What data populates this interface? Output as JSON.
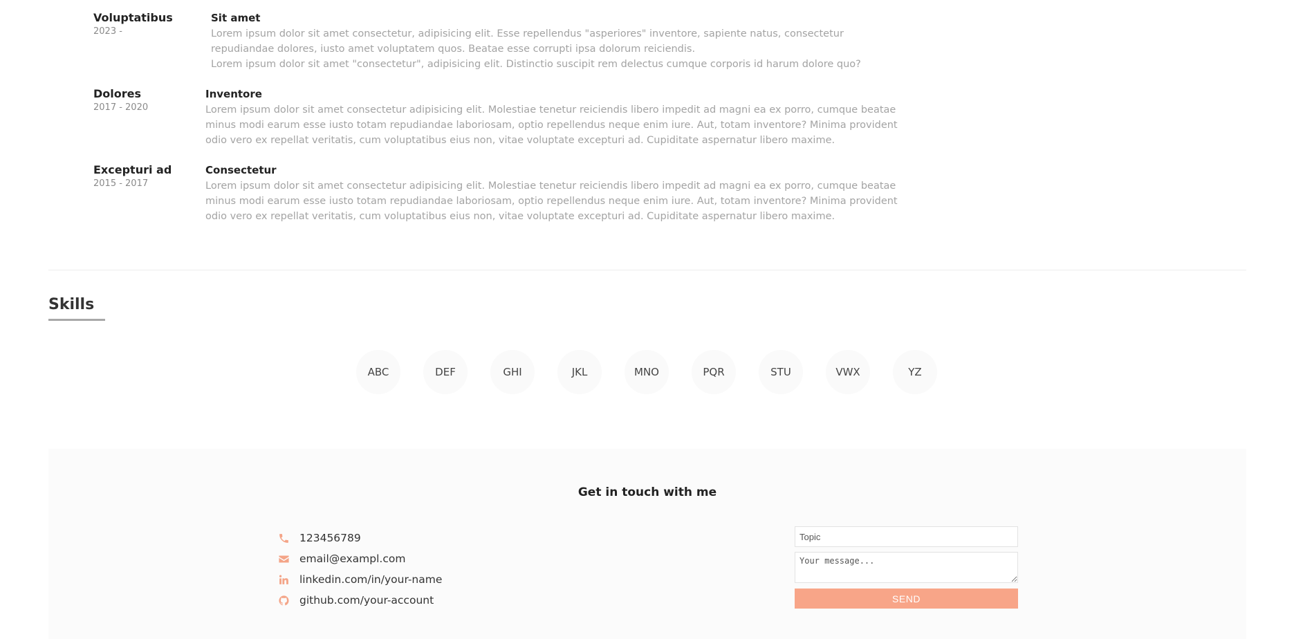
{
  "experience": [
    {
      "period": "Voluptatibus",
      "years": "2023 -",
      "role": "Sit amet",
      "lines": [
        "Lorem ipsum dolor sit amet consectetur, adipisicing elit. Esse repellendus \"asperiores\" inventore, sapiente natus, consectetur repudiandae dolores, iusto amet voluptatem quos. Beatae esse corrupti ipsa dolorum reiciendis.",
        "Lorem ipsum dolor sit amet \"consectetur\", adipisicing elit. Distinctio suscipit rem delectus cumque corporis id harum dolore quo?"
      ]
    },
    {
      "period": "Dolores",
      "years": "2017 - 2020",
      "role": "Inventore",
      "lines": [
        "Lorem ipsum dolor sit amet consectetur adipisicing elit. Molestiae tenetur reiciendis libero impedit ad magni ea ex porro, cumque beatae minus modi earum esse iusto totam repudiandae laboriosam, optio repellendus neque enim iure. Aut, totam inventore? Minima provident odio vero ex repellat veritatis, cum voluptatibus eius non, vitae voluptate excepturi ad. Cupiditate aspernatur libero maxime."
      ]
    },
    {
      "period": "Excepturi ad",
      "years": "2015 - 2017",
      "role": "Consectetur",
      "lines": [
        "Lorem ipsum dolor sit amet consectetur adipisicing elit. Molestiae tenetur reiciendis libero impedit ad magni ea ex porro, cumque beatae minus modi earum esse iusto totam repudiandae laboriosam, optio repellendus neque enim iure. Aut, totam inventore? Minima provident odio vero ex repellat veritatis, cum voluptatibus eius non, vitae voluptate excepturi ad. Cupiditate aspernatur libero maxime."
      ]
    }
  ],
  "skills": {
    "title": "Skills",
    "items": [
      "ABC",
      "DEF",
      "GHI",
      "JKL",
      "MNO",
      "PQR",
      "STU",
      "VWX",
      "YZ"
    ]
  },
  "contact": {
    "title": "Get in touch with me",
    "phone": "123456789",
    "email": "email@exampl.com",
    "linkedin": "linkedin.com/in/your-name",
    "github": "github.com/your-account",
    "icons": [
      "phone-icon",
      "envelope-icon",
      "linkedin-icon",
      "github-icon"
    ],
    "accent_color": "#f8a588",
    "form": {
      "topic_placeholder": "Topic",
      "message_placeholder": "Your message...",
      "send_label": "SEND"
    }
  }
}
